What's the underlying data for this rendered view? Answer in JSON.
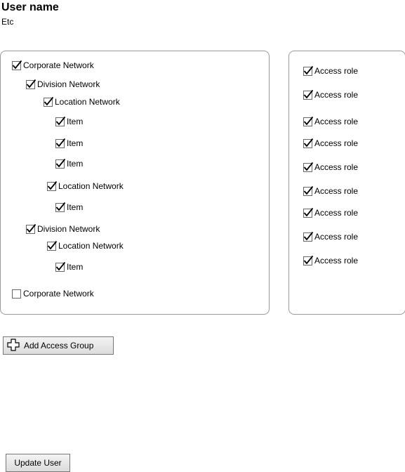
{
  "header": {
    "title": "User name",
    "subtitle": "Etc"
  },
  "tree": [
    {
      "label": "Corporate Network",
      "checked": true,
      "level": 0
    },
    {
      "label": "Division Network",
      "checked": true,
      "level": 1
    },
    {
      "label": "Location Network",
      "checked": true,
      "level": 2
    },
    {
      "label": "Item",
      "checked": true,
      "level": 3
    },
    {
      "label": "Item",
      "checked": true,
      "level": 3
    },
    {
      "label": "Item",
      "checked": true,
      "level": 3
    },
    {
      "label": "Location Network",
      "checked": true,
      "level": 2
    },
    {
      "label": "Item",
      "checked": true,
      "level": 3
    },
    {
      "label": "Division Network",
      "checked": true,
      "level": 1
    },
    {
      "label": "Location Network",
      "checked": true,
      "level": 2
    },
    {
      "label": "Item",
      "checked": true,
      "level": 3
    },
    {
      "label": "Corporate Network",
      "checked": false,
      "level": 0
    }
  ],
  "roles": [
    {
      "label": "Access role",
      "checked": true
    },
    {
      "label": "Access role",
      "checked": true
    },
    {
      "label": "Access role",
      "checked": true
    },
    {
      "label": "Access role",
      "checked": true
    },
    {
      "label": "Access role",
      "checked": true
    },
    {
      "label": "Access role",
      "checked": true
    },
    {
      "label": "Access role",
      "checked": true
    },
    {
      "label": "Access role",
      "checked": true
    },
    {
      "label": "Access role",
      "checked": true
    }
  ],
  "buttons": {
    "add_group": "Add Access Group",
    "update_user": "Update User"
  },
  "icons": {
    "add": "plus-outline-icon",
    "check": "checkmark-icon"
  }
}
